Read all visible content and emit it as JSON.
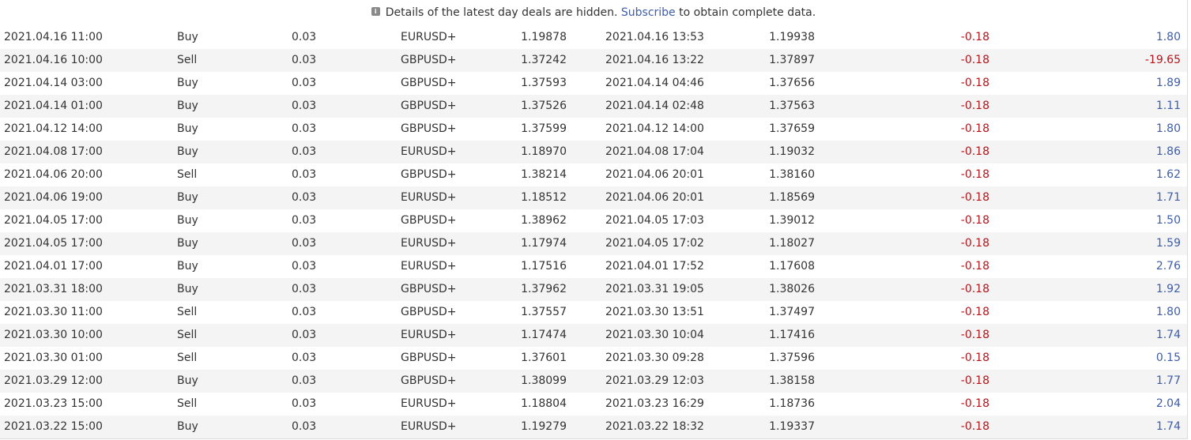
{
  "notice": {
    "icon": "info-icon",
    "text_before": "Details of the latest day deals are hidden.",
    "link": "Subscribe",
    "text_after": "to obtain complete data."
  },
  "colors": {
    "negative": "#b3151b",
    "positive": "#3e5da7",
    "stripe": "#f4f4f4"
  },
  "deals": [
    {
      "open_time": "2021.04.16 11:00",
      "type": "Buy",
      "volume": "0.03",
      "symbol": "EURUSD+",
      "open_price": "1.19878",
      "close_time": "2021.04.16 13:53",
      "close_price": "1.19938",
      "swap": "-0.18",
      "profit": "1.80"
    },
    {
      "open_time": "2021.04.16 10:00",
      "type": "Sell",
      "volume": "0.03",
      "symbol": "GBPUSD+",
      "open_price": "1.37242",
      "close_time": "2021.04.16 13:22",
      "close_price": "1.37897",
      "swap": "-0.18",
      "profit": "-19.65"
    },
    {
      "open_time": "2021.04.14 03:00",
      "type": "Buy",
      "volume": "0.03",
      "symbol": "GBPUSD+",
      "open_price": "1.37593",
      "close_time": "2021.04.14 04:46",
      "close_price": "1.37656",
      "swap": "-0.18",
      "profit": "1.89"
    },
    {
      "open_time": "2021.04.14 01:00",
      "type": "Buy",
      "volume": "0.03",
      "symbol": "GBPUSD+",
      "open_price": "1.37526",
      "close_time": "2021.04.14 02:48",
      "close_price": "1.37563",
      "swap": "-0.18",
      "profit": "1.11"
    },
    {
      "open_time": "2021.04.12 14:00",
      "type": "Buy",
      "volume": "0.03",
      "symbol": "GBPUSD+",
      "open_price": "1.37599",
      "close_time": "2021.04.12 14:00",
      "close_price": "1.37659",
      "swap": "-0.18",
      "profit": "1.80"
    },
    {
      "open_time": "2021.04.08 17:00",
      "type": "Buy",
      "volume": "0.03",
      "symbol": "EURUSD+",
      "open_price": "1.18970",
      "close_time": "2021.04.08 17:04",
      "close_price": "1.19032",
      "swap": "-0.18",
      "profit": "1.86"
    },
    {
      "open_time": "2021.04.06 20:00",
      "type": "Sell",
      "volume": "0.03",
      "symbol": "GBPUSD+",
      "open_price": "1.38214",
      "close_time": "2021.04.06 20:01",
      "close_price": "1.38160",
      "swap": "-0.18",
      "profit": "1.62"
    },
    {
      "open_time": "2021.04.06 19:00",
      "type": "Buy",
      "volume": "0.03",
      "symbol": "EURUSD+",
      "open_price": "1.18512",
      "close_time": "2021.04.06 20:01",
      "close_price": "1.18569",
      "swap": "-0.18",
      "profit": "1.71"
    },
    {
      "open_time": "2021.04.05 17:00",
      "type": "Buy",
      "volume": "0.03",
      "symbol": "GBPUSD+",
      "open_price": "1.38962",
      "close_time": "2021.04.05 17:03",
      "close_price": "1.39012",
      "swap": "-0.18",
      "profit": "1.50"
    },
    {
      "open_time": "2021.04.05 17:00",
      "type": "Buy",
      "volume": "0.03",
      "symbol": "EURUSD+",
      "open_price": "1.17974",
      "close_time": "2021.04.05 17:02",
      "close_price": "1.18027",
      "swap": "-0.18",
      "profit": "1.59"
    },
    {
      "open_time": "2021.04.01 17:00",
      "type": "Buy",
      "volume": "0.03",
      "symbol": "EURUSD+",
      "open_price": "1.17516",
      "close_time": "2021.04.01 17:52",
      "close_price": "1.17608",
      "swap": "-0.18",
      "profit": "2.76"
    },
    {
      "open_time": "2021.03.31 18:00",
      "type": "Buy",
      "volume": "0.03",
      "symbol": "GBPUSD+",
      "open_price": "1.37962",
      "close_time": "2021.03.31 19:05",
      "close_price": "1.38026",
      "swap": "-0.18",
      "profit": "1.92"
    },
    {
      "open_time": "2021.03.30 11:00",
      "type": "Sell",
      "volume": "0.03",
      "symbol": "GBPUSD+",
      "open_price": "1.37557",
      "close_time": "2021.03.30 13:51",
      "close_price": "1.37497",
      "swap": "-0.18",
      "profit": "1.80"
    },
    {
      "open_time": "2021.03.30 10:00",
      "type": "Sell",
      "volume": "0.03",
      "symbol": "EURUSD+",
      "open_price": "1.17474",
      "close_time": "2021.03.30 10:04",
      "close_price": "1.17416",
      "swap": "-0.18",
      "profit": "1.74"
    },
    {
      "open_time": "2021.03.30 01:00",
      "type": "Sell",
      "volume": "0.03",
      "symbol": "GBPUSD+",
      "open_price": "1.37601",
      "close_time": "2021.03.30 09:28",
      "close_price": "1.37596",
      "swap": "-0.18",
      "profit": "0.15"
    },
    {
      "open_time": "2021.03.29 12:00",
      "type": "Buy",
      "volume": "0.03",
      "symbol": "GBPUSD+",
      "open_price": "1.38099",
      "close_time": "2021.03.29 12:03",
      "close_price": "1.38158",
      "swap": "-0.18",
      "profit": "1.77"
    },
    {
      "open_time": "2021.03.23 15:00",
      "type": "Sell",
      "volume": "0.03",
      "symbol": "EURUSD+",
      "open_price": "1.18804",
      "close_time": "2021.03.23 16:29",
      "close_price": "1.18736",
      "swap": "-0.18",
      "profit": "2.04"
    },
    {
      "open_time": "2021.03.22 15:00",
      "type": "Buy",
      "volume": "0.03",
      "symbol": "EURUSD+",
      "open_price": "1.19279",
      "close_time": "2021.03.22 18:32",
      "close_price": "1.19337",
      "swap": "-0.18",
      "profit": "1.74"
    }
  ]
}
